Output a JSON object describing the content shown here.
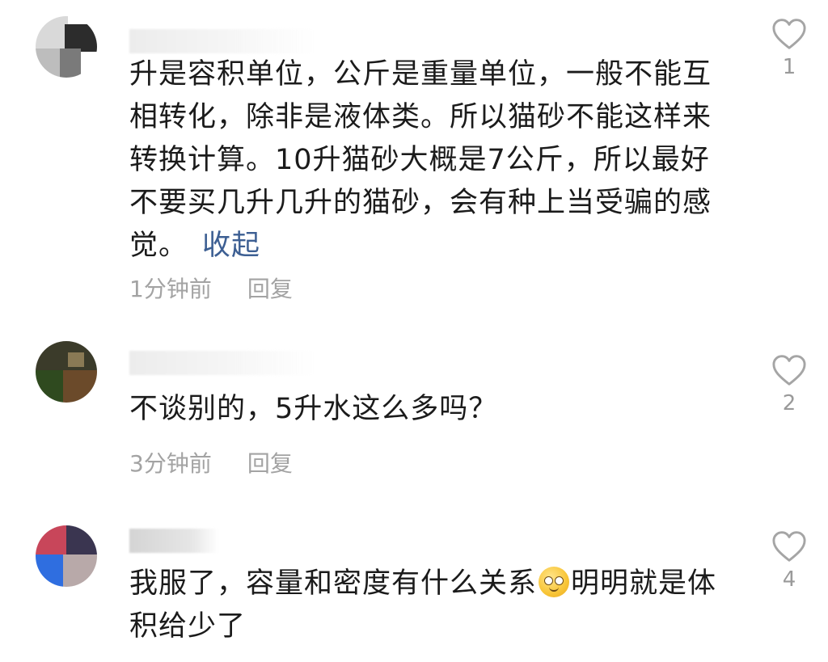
{
  "comments": [
    {
      "text": "升是容积单位，公斤是重量单位，一般不能互相转化，除非是液体类。所以猫砂不能这样来转换计算。10升猫砂大概是7公斤，所以最好不要买几升几升的猫砂，会有种上当受骗的感觉。",
      "collapse_label": "收起",
      "time": "1分钟前",
      "reply_label": "回复",
      "likes": "1",
      "like_icon": "heart-outline-icon",
      "avatar_colors": [
        "#2c2c2c",
        "#7a7a7a",
        "#bdbdbd",
        "#4a4a4a"
      ]
    },
    {
      "text": "不谈别的，5升水这么多吗？",
      "time": "3分钟前",
      "reply_label": "回复",
      "likes": "2",
      "like_icon": "heart-outline-icon",
      "avatar_colors": [
        "#3b3b2a",
        "#4a3a1e",
        "#2f4a1f",
        "#6b4a2a"
      ]
    },
    {
      "text_before_emoji": "我服了，容量和密度有什么关系",
      "emoji": "flushed-face-emoji",
      "text_after_emoji": "明明就是体积给少了",
      "likes": "4",
      "like_icon": "heart-outline-icon",
      "avatar_colors": [
        "#c8465a",
        "#3a3550",
        "#2f6ee0",
        "#b8a9a9"
      ]
    }
  ]
}
